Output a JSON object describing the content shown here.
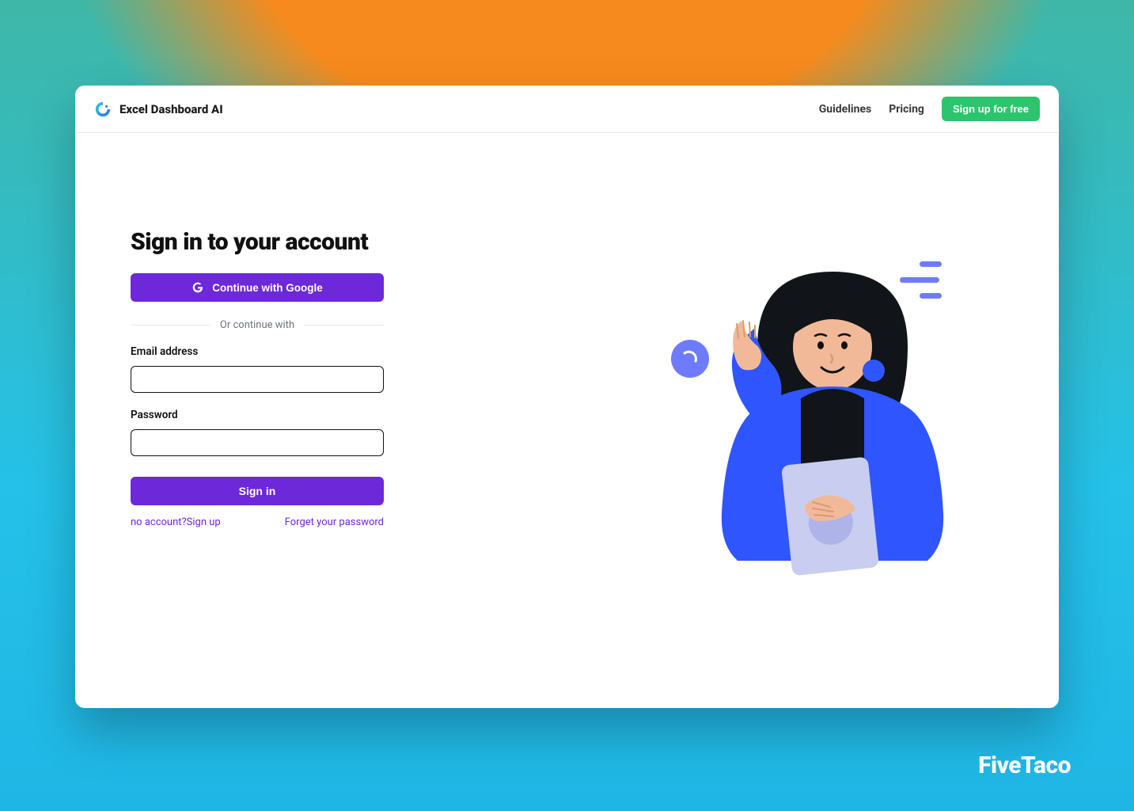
{
  "header": {
    "brand_name": "Excel Dashboard AI",
    "nav": {
      "guidelines": "Guidelines",
      "pricing": "Pricing",
      "signup_button": "Sign up for free"
    }
  },
  "auth": {
    "heading": "Sign in to your account",
    "google_button": "Continue with Google",
    "divider_text": "Or continue with",
    "email_label": "Email address",
    "password_label": "Password",
    "signin_button": "Sign in",
    "signup_link_prefix": "no account?",
    "signup_link": "Sign up",
    "forgot_link": "Forget your password"
  },
  "watermark": "FiveTaco",
  "colors": {
    "accent_purple": "#6d28d9",
    "accent_green": "#2cc46c",
    "bg_orange": "#f68a1e",
    "bg_teal": "#27c0e6"
  }
}
